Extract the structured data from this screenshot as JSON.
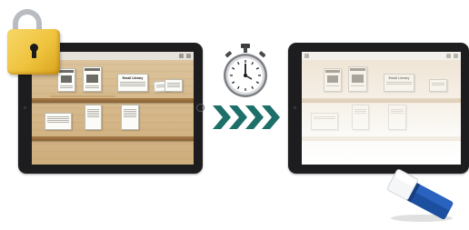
{
  "colors": {
    "tablet_frame": "#1d1d1f",
    "shelf_wood": "#d5b88b",
    "lock_gold": "#efc33d",
    "arrow_teal": "#1d6f69",
    "eraser_blue": "#1c4fa0"
  },
  "icons": {
    "lock": "padlock-icon",
    "stopwatch": "stopwatch-icon",
    "arrows": "chevron-right-icon",
    "eraser": "eraser-icon"
  },
  "tablet_before": {
    "state": "locked",
    "book_titles": [
      "Email Library"
    ]
  },
  "tablet_after": {
    "state": "erased",
    "book_titles": [
      "Email Library"
    ]
  }
}
